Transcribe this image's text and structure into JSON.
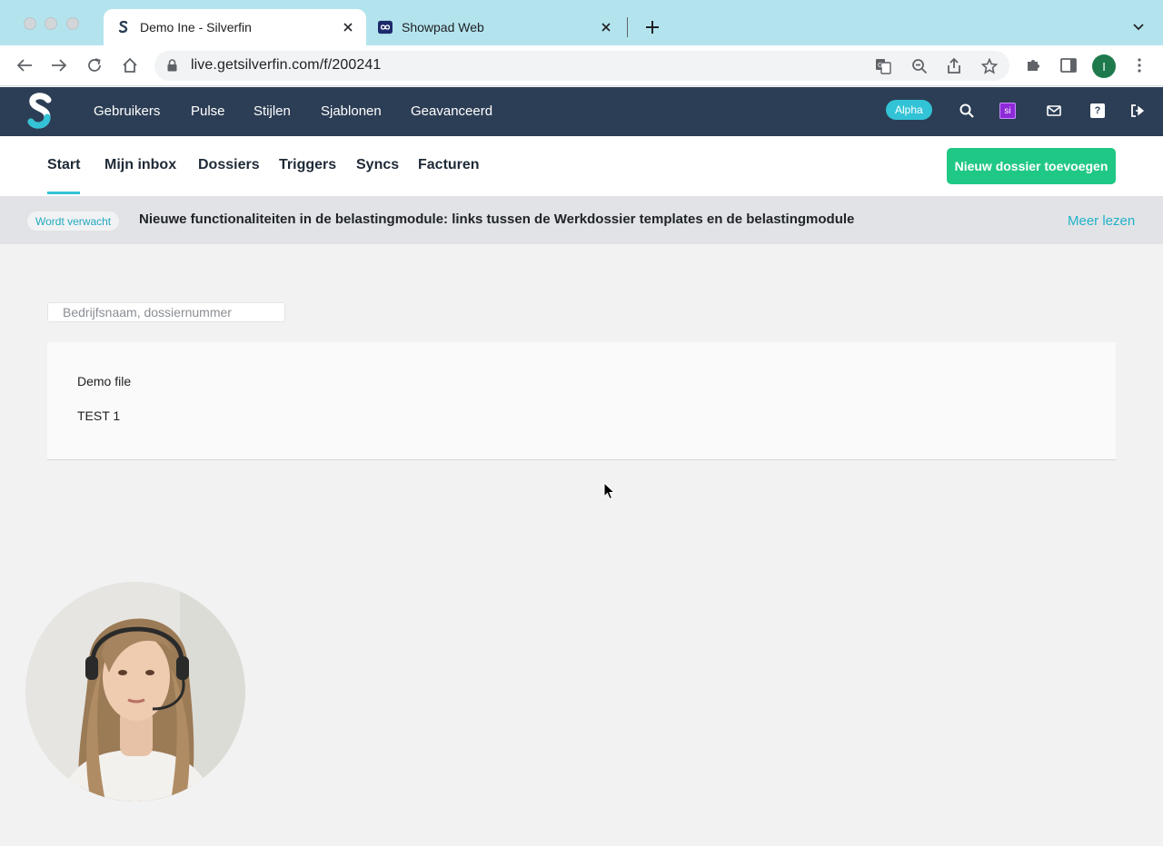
{
  "browser": {
    "tabs": [
      {
        "title": "Demo Ine - Silverfin",
        "active": true
      },
      {
        "title": "Showpad Web",
        "active": false
      }
    ],
    "url": "live.getsilverfin.com/f/200241",
    "profile_initial": "I"
  },
  "navbar": {
    "items": [
      "Gebruikers",
      "Pulse",
      "Stijlen",
      "Sjablonen",
      "Geavanceerd"
    ],
    "alpha_label": "Alpha",
    "si_label": "si",
    "help_label": "?"
  },
  "subnav": {
    "items": [
      "Start",
      "Mijn inbox",
      "Dossiers",
      "Triggers",
      "Syncs",
      "Facturen"
    ],
    "active_index": 0,
    "new_button": "Nieuw dossier toevoegen"
  },
  "banner": {
    "badge": "Wordt verwacht",
    "text": "Nieuwe functionaliteiten in de belastingmodule: links tussen de Werkdossier templates en de belastingmodule",
    "link": "Meer lezen"
  },
  "search": {
    "placeholder": "Bedrijfsnaam, dossiernummer"
  },
  "files": [
    "Demo file",
    "TEST 1"
  ],
  "colors": {
    "tabstrip": "#b3e4ee",
    "navbar": "#2c3e55",
    "accent": "#32c3d6",
    "primary_button": "#20c885"
  }
}
